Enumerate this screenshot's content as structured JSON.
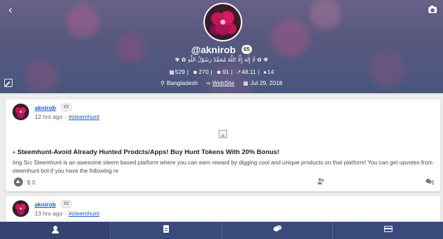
{
  "profile": {
    "username": "@aknirob",
    "reputation": "65",
    "about": "✾ ✿ لَا إِلٰهَ إِلَّا اللّٰهُ مُحَمَّدٌ رَسُوْلُ اللّٰهِ ✿ ✾",
    "stats": [
      {
        "icon": "posts-icon",
        "value": "529"
      },
      {
        "icon": "followers-icon",
        "value": "270"
      },
      {
        "icon": "following-icon",
        "value": "91"
      },
      {
        "icon": "trend-icon",
        "value": "48.11"
      },
      {
        "icon": "steem-icon",
        "value": "14"
      }
    ],
    "location": "Bangladesh",
    "website_label": "WebSite",
    "joined": "Jul 29, 2018"
  },
  "posts": [
    {
      "author": "aknirob",
      "reputation": "65",
      "time": "12 hrs ago",
      "tag": "#steemhunt",
      "title": "Steemhunt-Avoid Already Hunted Prodcts/Apps! Buy Hunt Tokens With 20% Bonus!",
      "excerpt": "Img Src Steemhunt is an awesome steem based platform where you can earn reward by digging cool and unique products on that platform! You can get upvotes from steemhunt bot if you have the following re",
      "payout": "$ 0",
      "comments": "1"
    },
    {
      "author": "aknirob",
      "reputation": "65",
      "time": "13 hrs ago",
      "tag": "#steemhunt"
    }
  ],
  "nav": [
    {
      "name": "profile-tab",
      "icon": "user-icon"
    },
    {
      "name": "posts-tab",
      "icon": "document-icon"
    },
    {
      "name": "comments-tab",
      "icon": "chat-icon"
    },
    {
      "name": "wallet-tab",
      "icon": "wallet-icon"
    }
  ],
  "colors": {
    "nav_bg": "#3a4a7a",
    "link": "#1e5bc6",
    "card_bg": "#ffffff",
    "page_bg": "#ececec"
  }
}
